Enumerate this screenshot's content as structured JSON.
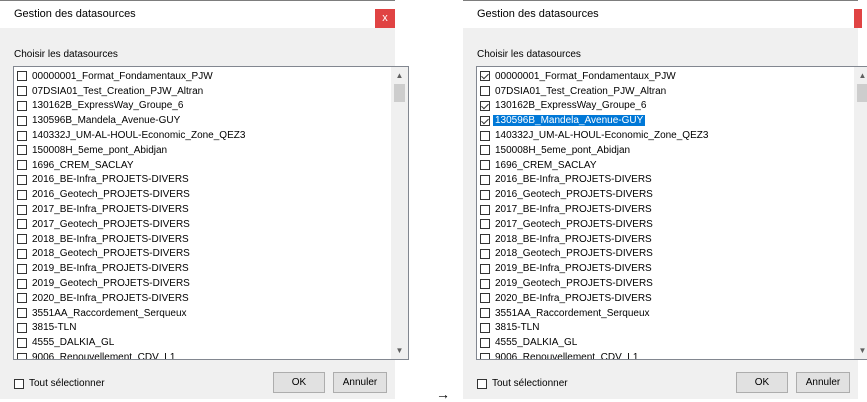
{
  "left_dialog": {
    "title": "Gestion des datasources",
    "close_label": "x",
    "prompt": "Choisir les datasources",
    "items": [
      {
        "label": "00000001_Format_Fondamentaux_PJW",
        "checked": false
      },
      {
        "label": "07DSIA01_Test_Creation_PJW_Altran",
        "checked": false
      },
      {
        "label": "130162B_ExpressWay_Groupe_6",
        "checked": false
      },
      {
        "label": "130596B_Mandela_Avenue-GUY",
        "checked": false
      },
      {
        "label": "140332J_UM-AL-HOUL-Economic_Zone_QEZ3",
        "checked": false
      },
      {
        "label": "150008H_5eme_pont_Abidjan",
        "checked": false
      },
      {
        "label": "1696_CREM_SACLAY",
        "checked": false
      },
      {
        "label": "2016_BE-Infra_PROJETS-DIVERS",
        "checked": false
      },
      {
        "label": "2016_Geotech_PROJETS-DIVERS",
        "checked": false
      },
      {
        "label": "2017_BE-Infra_PROJETS-DIVERS",
        "checked": false
      },
      {
        "label": "2017_Geotech_PROJETS-DIVERS",
        "checked": false
      },
      {
        "label": "2018_BE-Infra_PROJETS-DIVERS",
        "checked": false
      },
      {
        "label": "2018_Geotech_PROJETS-DIVERS",
        "checked": false
      },
      {
        "label": "2019_BE-Infra_PROJETS-DIVERS",
        "checked": false
      },
      {
        "label": "2019_Geotech_PROJETS-DIVERS",
        "checked": false
      },
      {
        "label": "2020_BE-Infra_PROJETS-DIVERS",
        "checked": false
      },
      {
        "label": "3551AA_Raccordement_Serqueux",
        "checked": false
      },
      {
        "label": "3815-TLN",
        "checked": false
      },
      {
        "label": "4555_DALKIA_GL",
        "checked": false
      },
      {
        "label": "9006_Renouvellement_CDV_L1",
        "checked": false
      }
    ],
    "select_all_label": "Tout sélectionner",
    "ok_label": "OK",
    "cancel_label": "Annuler"
  },
  "right_dialog": {
    "title": "Gestion des datasources",
    "prompt": "Choisir les datasources",
    "selected_index": 3,
    "items": [
      {
        "label": "00000001_Format_Fondamentaux_PJW",
        "checked": true
      },
      {
        "label": "07DSIA01_Test_Creation_PJW_Altran",
        "checked": false
      },
      {
        "label": "130162B_ExpressWay_Groupe_6",
        "checked": true
      },
      {
        "label": "130596B_Mandela_Avenue-GUY",
        "checked": true
      },
      {
        "label": "140332J_UM-AL-HOUL-Economic_Zone_QEZ3",
        "checked": false
      },
      {
        "label": "150008H_5eme_pont_Abidjan",
        "checked": false
      },
      {
        "label": "1696_CREM_SACLAY",
        "checked": false
      },
      {
        "label": "2016_BE-Infra_PROJETS-DIVERS",
        "checked": false
      },
      {
        "label": "2016_Geotech_PROJETS-DIVERS",
        "checked": false
      },
      {
        "label": "2017_BE-Infra_PROJETS-DIVERS",
        "checked": false
      },
      {
        "label": "2017_Geotech_PROJETS-DIVERS",
        "checked": false
      },
      {
        "label": "2018_BE-Infra_PROJETS-DIVERS",
        "checked": false
      },
      {
        "label": "2018_Geotech_PROJETS-DIVERS",
        "checked": false
      },
      {
        "label": "2019_BE-Infra_PROJETS-DIVERS",
        "checked": false
      },
      {
        "label": "2019_Geotech_PROJETS-DIVERS",
        "checked": false
      },
      {
        "label": "2020_BE-Infra_PROJETS-DIVERS",
        "checked": false
      },
      {
        "label": "3551AA_Raccordement_Serqueux",
        "checked": false
      },
      {
        "label": "3815-TLN",
        "checked": false
      },
      {
        "label": "4555_DALKIA_GL",
        "checked": false
      },
      {
        "label": "9006_Renouvellement_CDV_L1",
        "checked": false
      }
    ],
    "select_all_label": "Tout sélectionner",
    "ok_label": "OK",
    "cancel_label": "Annuler"
  },
  "arrow_glyph": "→",
  "colors": {
    "selection": "#0078d7",
    "close": "#e04343"
  },
  "icons": {
    "close": "close-icon",
    "scroll_up": "chevron-up-icon",
    "scroll_down": "chevron-down-icon"
  }
}
